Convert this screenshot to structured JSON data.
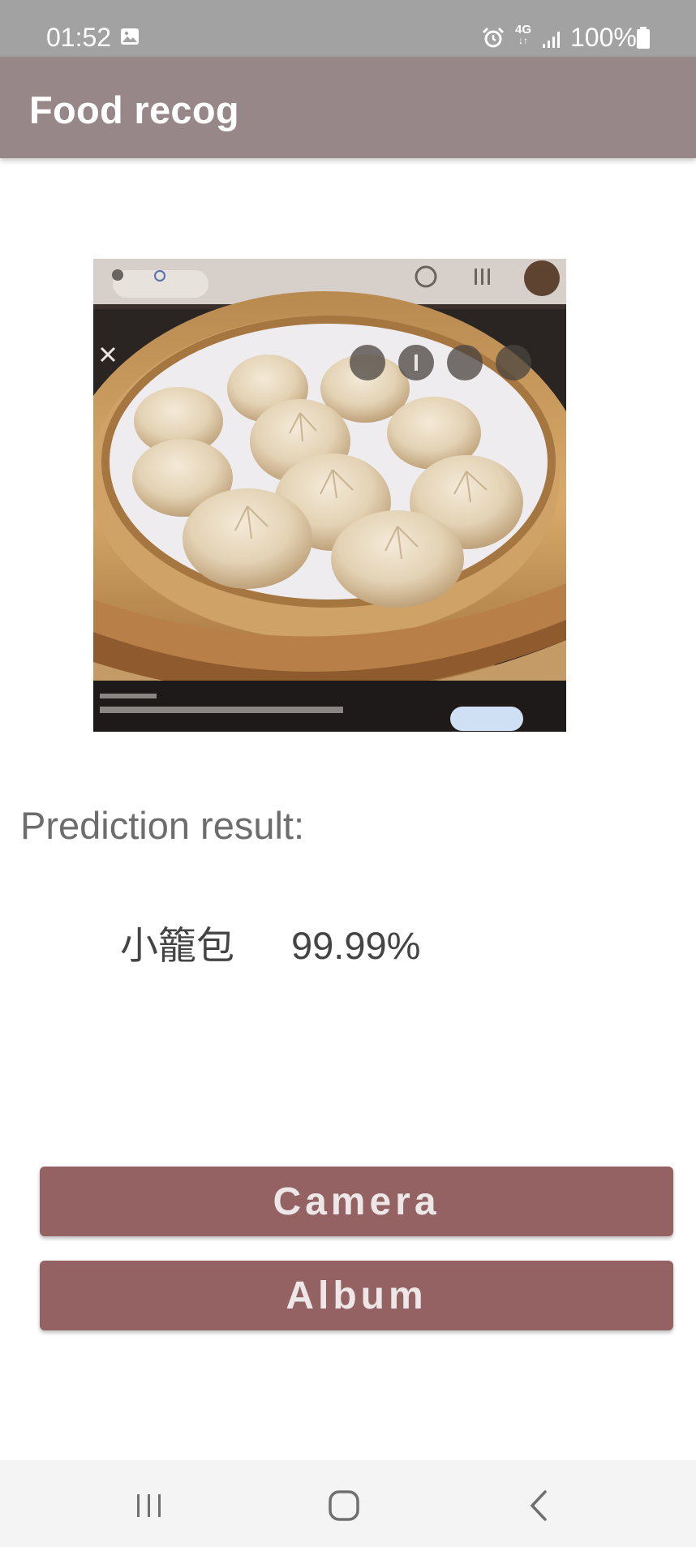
{
  "status_bar": {
    "time": "01:52",
    "network": "4G",
    "battery": "100%",
    "icons": [
      "image-notification-icon",
      "alarm-icon",
      "signal-icon",
      "battery-icon"
    ]
  },
  "app_bar": {
    "title": "Food recog"
  },
  "photo": {
    "subject": "steamed soup dumplings in bamboo steamer"
  },
  "prediction": {
    "label": "Prediction result:",
    "name": "小籠包",
    "score": "99.99%"
  },
  "buttons": {
    "camera": "Camera",
    "album": "Album"
  },
  "nav_bar": {
    "icons": [
      "recent-apps-icon",
      "home-icon",
      "back-icon"
    ]
  },
  "colors": {
    "status_bar": "#a2a2a2",
    "app_bar": "#978788",
    "button": "#946263",
    "nav_bar": "#f4f4f4"
  }
}
